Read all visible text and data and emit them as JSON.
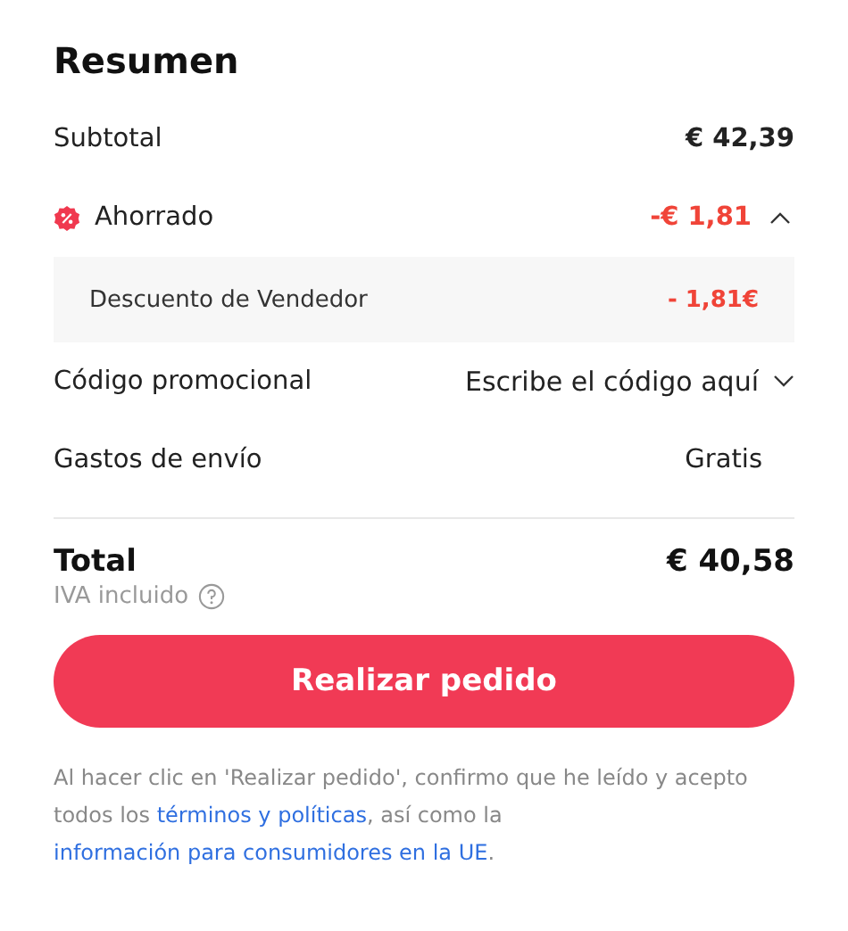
{
  "title": "Resumen",
  "subtotal": {
    "label": "Subtotal",
    "value": "€ 42,39"
  },
  "savings": {
    "label": "Ahorrado",
    "value": "-€ 1,81",
    "expanded": true,
    "details": [
      {
        "label": "Descuento de Vendedor",
        "value": "- 1,81€"
      }
    ]
  },
  "promo": {
    "label": "Código promocional",
    "placeholder": "Escribe el código aquí"
  },
  "shipping": {
    "label": "Gastos de envío",
    "value": "Gratis"
  },
  "total": {
    "label": "Total",
    "value": "€ 40,58",
    "note": "IVA incluido"
  },
  "order_button": "Realizar pedido",
  "legal": {
    "before": "Al hacer clic en 'Realizar pedido', confirmo que he leído y acepto todos los",
    "link1": "términos y políticas",
    "middle": ", así como la",
    "link2": "información para consumidores en la UE",
    "after": "."
  }
}
